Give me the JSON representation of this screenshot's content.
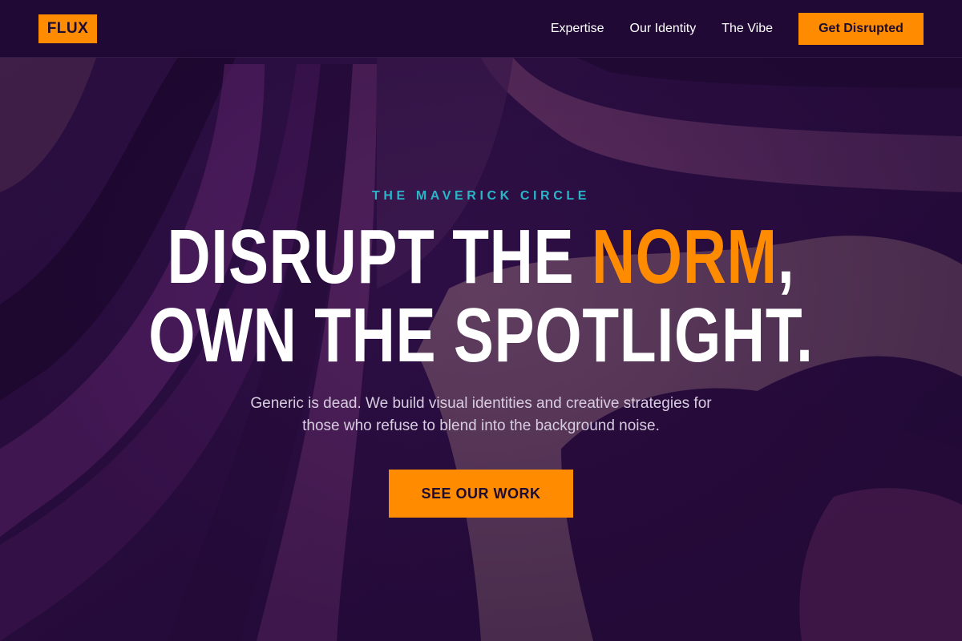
{
  "header": {
    "logo": "FLUX",
    "nav": [
      {
        "label": "Expertise"
      },
      {
        "label": "Our Identity"
      },
      {
        "label": "The Vibe"
      }
    ],
    "cta_label": "Get Disrupted"
  },
  "hero": {
    "eyebrow": "THE MAVERICK CIRCLE",
    "headline_part1": "DISRUPT THE ",
    "headline_accent": "NORM",
    "headline_part2": ",",
    "headline_line2": "OWN THE SPOTLIGHT.",
    "subtitle_line1": "Generic is dead. We build visual identities and creative strategies for",
    "subtitle_line2": "those who refuse to blend into the background noise.",
    "cta_label": "SEE OUR WORK"
  },
  "colors": {
    "accent": "#ff8c00",
    "eyebrow": "#29b6c8",
    "background": "#2a1040",
    "text": "#ffffff"
  }
}
